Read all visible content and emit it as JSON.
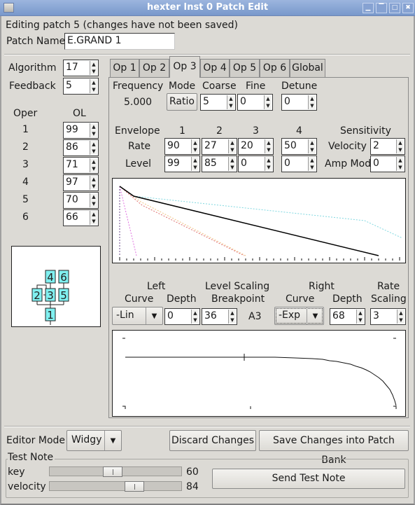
{
  "window": {
    "title": "hexter Inst 0 Patch Edit",
    "buttons": [
      "minimize",
      "maximize-alt",
      "restore",
      "close"
    ]
  },
  "status": "Editing patch 5 (changes have not been saved)",
  "patch_name": {
    "label": "Patch Name",
    "value": "E.GRAND 1"
  },
  "algorithm": {
    "label": "Algorithm",
    "value": "17"
  },
  "feedback": {
    "label": "Feedback",
    "value": "5"
  },
  "operators": {
    "oper_header": "Oper",
    "ol_header": "OL",
    "rows": [
      {
        "num": "1",
        "ol": "99"
      },
      {
        "num": "2",
        "ol": "86"
      },
      {
        "num": "3",
        "ol": "71"
      },
      {
        "num": "4",
        "ol": "97"
      },
      {
        "num": "5",
        "ol": "70"
      },
      {
        "num": "6",
        "ol": "66"
      }
    ]
  },
  "algorithm_diagram": {
    "operators": [
      "1",
      "2",
      "3",
      "4",
      "5",
      "6"
    ],
    "box_color": "#80f0f0"
  },
  "tabs": [
    "Op 1",
    "Op 2",
    "Op 3",
    "Op 4",
    "Op 5",
    "Op 6",
    "Global"
  ],
  "active_tab": "Op 3",
  "op": {
    "frequency_label": "Frequency",
    "frequency_value": "5.000",
    "mode_label": "Mode",
    "mode_value": "Ratio",
    "coarse_label": "Coarse",
    "coarse_value": "5",
    "fine_label": "Fine",
    "fine_value": "0",
    "detune_label": "Detune",
    "detune_value": "0",
    "envelope": {
      "label": "Envelope",
      "rate_label": "Rate",
      "level_label": "Level",
      "stages": [
        "1",
        "2",
        "3",
        "4"
      ],
      "rates": [
        "90",
        "27",
        "20",
        "50"
      ],
      "levels": [
        "99",
        "85",
        "0",
        "0"
      ]
    },
    "sensitivity": {
      "label": "Sensitivity",
      "velocity_label": "Velocity",
      "velocity_value": "2",
      "ampmod_label": "Amp Mod",
      "ampmod_value": "0"
    },
    "scaling": {
      "left_label": "Left",
      "curve_label": "Curve",
      "depth_label": "Depth",
      "level_scaling_label": "Level Scaling",
      "breakpoint_label": "Breakpoint",
      "right_label": "Right",
      "rate_label": "Rate",
      "scaling_label": "Scaling",
      "left_curve": "-Lin",
      "left_depth": "0",
      "breakpoint_value": "36",
      "breakpoint_note": "A3",
      "right_curve": "-Exp",
      "right_depth": "68",
      "rate_scaling": "3"
    }
  },
  "envelope_colors": {
    "current": "#000000",
    "op1": "#e070e0",
    "op2": "#e07070",
    "op4": "#f0c080",
    "op5": "#80d8e0",
    "op6": "#c080e0"
  },
  "editor_mode": {
    "label": "Editor Mode",
    "value": "Widgy"
  },
  "buttons": {
    "discard": "Discard Changes",
    "save": "Save Changes into Patch Bank",
    "send_test_note": "Send Test Note"
  },
  "test_note": {
    "title": "Test Note",
    "key_label": "key",
    "key_value": "60",
    "key_fraction": 0.47,
    "velocity_label": "velocity",
    "velocity_value": "84",
    "velocity_fraction": 0.66
  }
}
